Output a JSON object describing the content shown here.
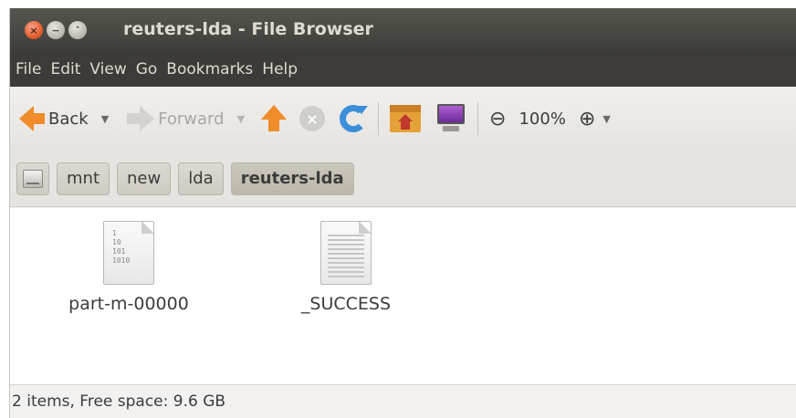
{
  "window": {
    "title": "reuters-lda - File Browser",
    "buttons": {
      "close": "×",
      "minimize": "−",
      "maximize": "˄"
    }
  },
  "menubar": [
    "File",
    "Edit",
    "View",
    "Go",
    "Bookmarks",
    "Help"
  ],
  "toolbar": {
    "back_label": "Back",
    "forward_label": "Forward",
    "forward_enabled": false,
    "stop_enabled": false,
    "zoom_level": "100%",
    "icons": [
      "back-arrow-icon",
      "up-arrow-icon",
      "stop-icon",
      "reload-icon",
      "home-folder-icon",
      "computer-icon",
      "zoom-out-icon",
      "zoom-in-icon"
    ]
  },
  "pathbar": {
    "crumbs": [
      "mnt",
      "new",
      "lda",
      "reuters-lda"
    ],
    "active": "reuters-lda"
  },
  "files": [
    {
      "name": "part-m-00000",
      "icon": "binary-file-icon",
      "binary_preview": "1\n10\n101\n1010"
    },
    {
      "name": "_SUCCESS",
      "icon": "text-file-icon"
    }
  ],
  "status": {
    "text": "2 items, Free space: 9.6 GB"
  },
  "colors": {
    "titlebar": "#3c3b37",
    "accent_orange": "#f08c2a",
    "close_button": "#e35f2d"
  }
}
